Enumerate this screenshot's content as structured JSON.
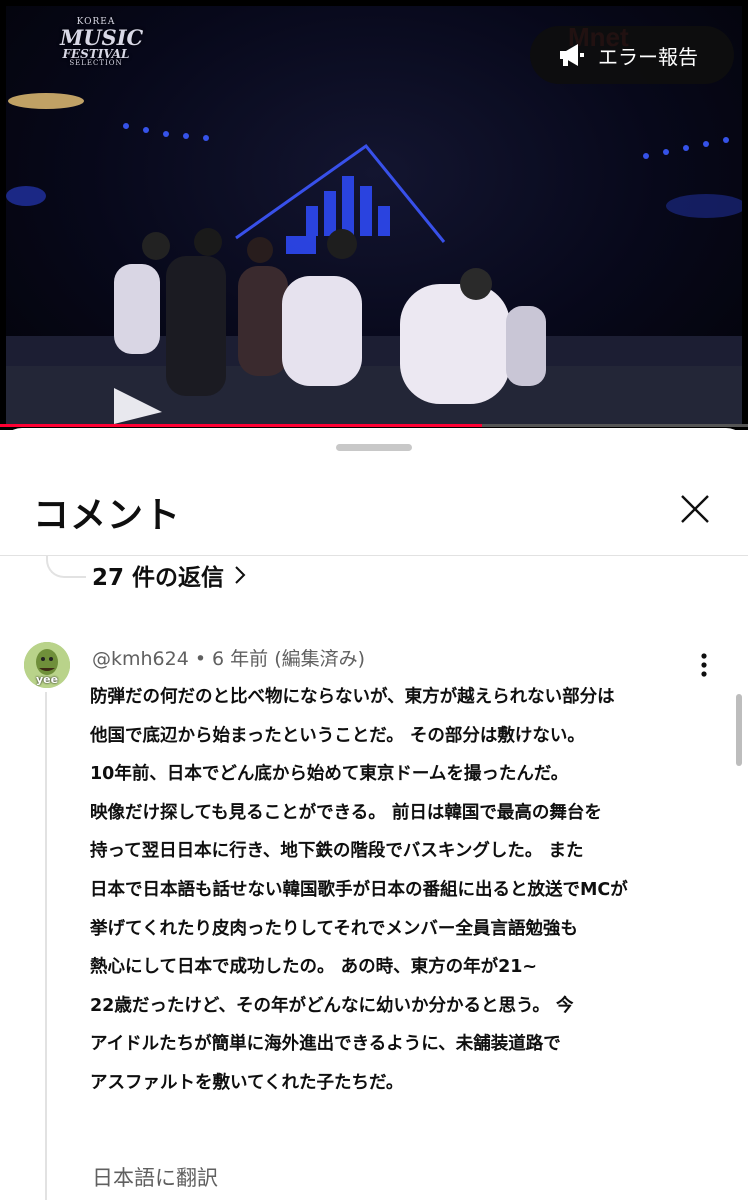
{
  "video": {
    "festival_logo": {
      "line1": "MUSIC",
      "line2": "FESTIVAL",
      "line3": "SELECTION"
    },
    "channel_watermark": "Mnet",
    "report_label": "エラー報告",
    "progress_fraction": 0.645
  },
  "comments_panel": {
    "title": "コメント",
    "replies_label": "27 件の返信",
    "comment": {
      "handle": "@kmh624",
      "separator": "•",
      "age": "6 年前",
      "edited": "(編集済み)",
      "avatar_text": "yee",
      "lines": [
        "防弾だの何だのと比べ物にならないが、東方が越えられない部分は",
        "他国で底辺から始まったということだ。 その部分は敷けない。",
        "10年前、日本でどん底から始めて東京ドームを撮ったんだ。",
        "映像だけ探しても見ることができる。 前日は韓国で最高の舞台を",
        "持って翌日日本に行き、地下鉄の階段でバスキングした。 また",
        "日本で日本語も話せない韓国歌手が日本の番組に出ると放送でMCが",
        "挙げてくれたり皮肉ったりしてそれでメンバー全員言語勉強も",
        "熱心にして日本で成功したの。 あの時、東方の年が21~",
        "22歳だったけど、その年がどんなに幼いか分かると思う。 今",
        "アイドルたちが簡単に海外進出できるように、未舗装道路で",
        "アスファルトを敷いてくれた子たちだ。"
      ],
      "translate_label": "日本語に翻訳"
    }
  },
  "colors": {
    "progress_red": "#ff0033",
    "text_primary": "#0f0f0f",
    "text_secondary": "#606060"
  }
}
